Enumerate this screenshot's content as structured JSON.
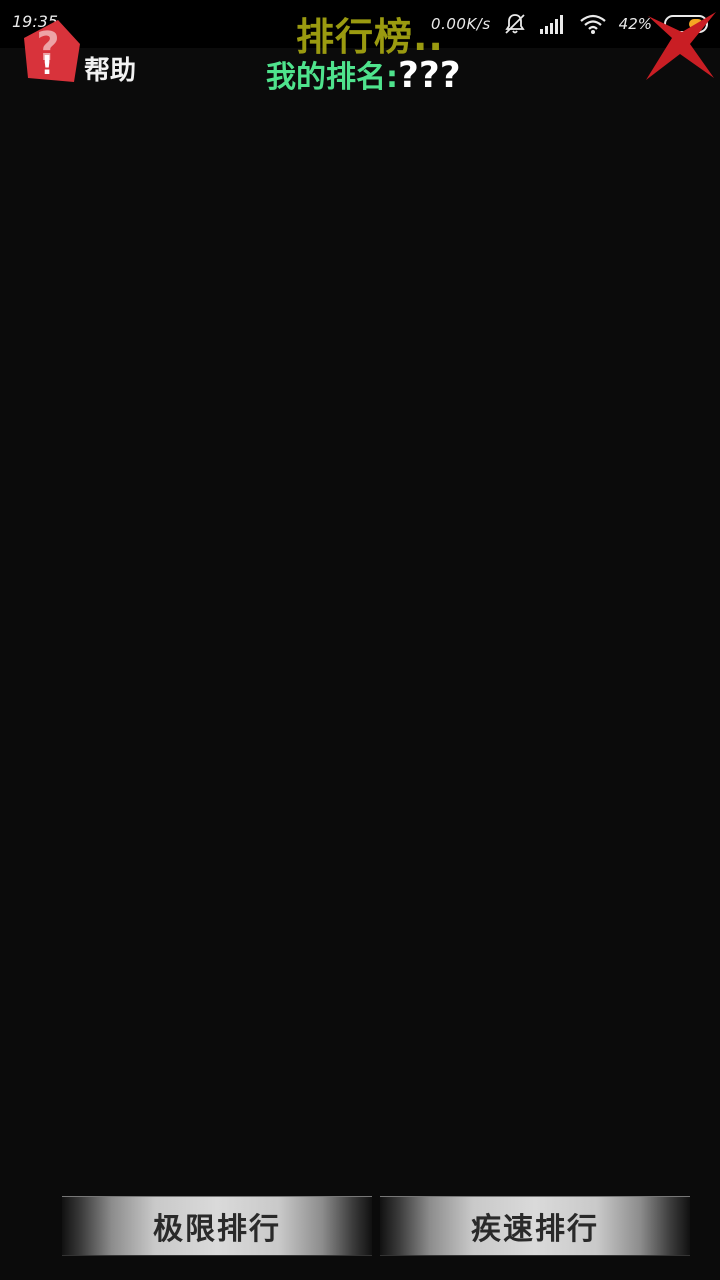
{
  "status_bar": {
    "time": "19:35",
    "net_speed": "0.00K/s",
    "battery_percent": "42%",
    "battery_level": 0.42
  },
  "header": {
    "help_label": "帮助",
    "title": "排行榜..",
    "my_rank_label": "我的排名:",
    "my_rank_value": "???"
  },
  "bottom_tabs": [
    {
      "label": "极限排行"
    },
    {
      "label": "疾速排行"
    }
  ],
  "colors": {
    "background": "#0b0b0b",
    "title": "#9a9a10",
    "rank_label": "#4fe38d",
    "help_icon": "#d8333b",
    "close_icon": "#c91e24",
    "battery_fill": "#f5a623"
  },
  "icons": {
    "help": "help-question-icon",
    "close": "close-x-icon",
    "mute": "bell-off-icon",
    "signal": "signal-icon",
    "wifi": "wifi-icon",
    "battery": "battery-icon"
  }
}
